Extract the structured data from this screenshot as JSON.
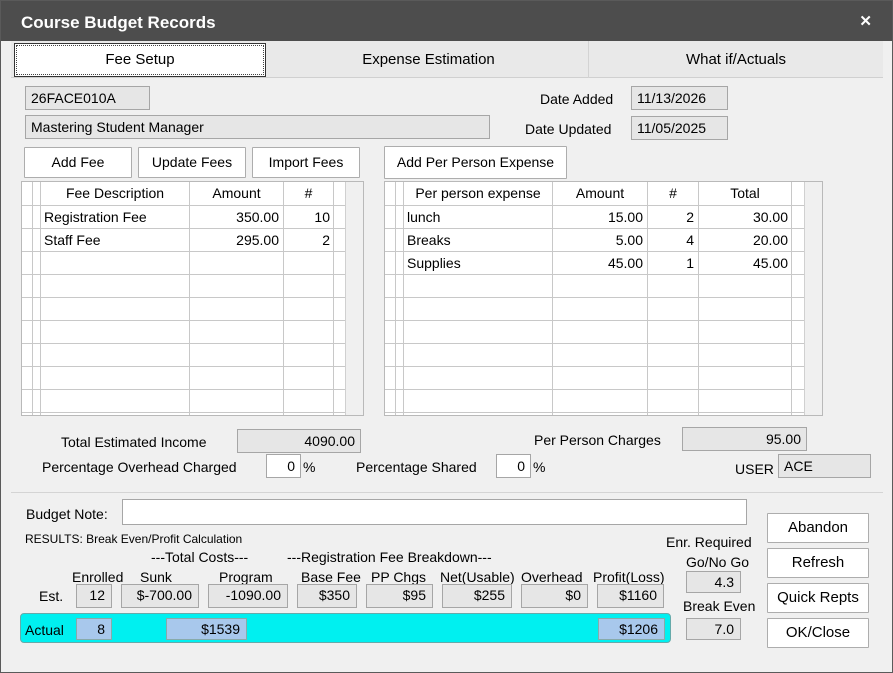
{
  "window": {
    "title": "Course Budget Records",
    "close": "✕"
  },
  "tabs": [
    {
      "label": "Fee Setup"
    },
    {
      "label": "Expense Estimation"
    },
    {
      "label": "What if/Actuals"
    }
  ],
  "course": {
    "code": "26FACE010A",
    "name": "Mastering Student Manager",
    "date_added_label": "Date Added",
    "date_added": "11/13/2026",
    "date_updated_label": "Date Updated",
    "date_updated": "11/05/2025"
  },
  "buttons": {
    "add_fee": "Add Fee",
    "update_fees": "Update Fees",
    "import_fees": "Import Fees",
    "add_pp_expense": "Add Per Person Expense",
    "abandon": "Abandon",
    "refresh": "Refresh",
    "quick_repts": "Quick Repts",
    "ok_close": "OK/Close"
  },
  "fees_grid": {
    "headers": [
      "Fee Description",
      "Amount",
      "#"
    ],
    "rows": [
      [
        "Registration Fee",
        "350.00",
        "10"
      ],
      [
        "Staff Fee",
        "295.00",
        "2"
      ]
    ]
  },
  "expense_grid": {
    "headers": [
      "Per person expense",
      "Amount",
      "#",
      "Total"
    ],
    "rows": [
      [
        "lunch",
        "15.00",
        "2",
        "30.00"
      ],
      [
        "Breaks",
        "5.00",
        "4",
        "20.00"
      ],
      [
        "Supplies",
        "45.00",
        "1",
        "45.00"
      ]
    ]
  },
  "totals": {
    "income_label": "Total Estimated Income",
    "income": "4090.00",
    "overhead_label": "Percentage Overhead Charged",
    "overhead": "0",
    "pct": "%",
    "shared_label": "Percentage Shared",
    "shared": "0",
    "pp_label": "Per Person Charges",
    "pp": "95.00",
    "user_label": "USER",
    "user": "ACE"
  },
  "budget_note": {
    "label": "Budget Note:",
    "value": ""
  },
  "results": {
    "heading": "RESULTS: Break Even/Profit Calculation",
    "total_costs": "---Total Costs---",
    "reg_breakdown": "---Registration Fee Breakdown---",
    "col_enrolled": "Enrolled",
    "col_sunk": "Sunk",
    "col_program": "Program",
    "col_base": "Base Fee",
    "col_pp": "PP Chgs",
    "col_net": "Net(Usable)",
    "col_overhead": "Overhead",
    "col_profit": "Profit(Loss)",
    "est_label": "Est.",
    "est": {
      "enrolled": "12",
      "sunk": "$-700.00",
      "program": "-1090.00",
      "base": "$350",
      "pp": "$95",
      "net": "$255",
      "overhead": "$0",
      "profit": "$1160"
    },
    "actual_label": "Actual",
    "actual": {
      "enrolled": "8",
      "program": "$1539",
      "profit": "$1206"
    },
    "enr_required": "Enr. Required",
    "go_no_go": "Go/No Go",
    "go_value": "4.3",
    "break_even_label": "Break Even",
    "break_even": "7.0"
  }
}
